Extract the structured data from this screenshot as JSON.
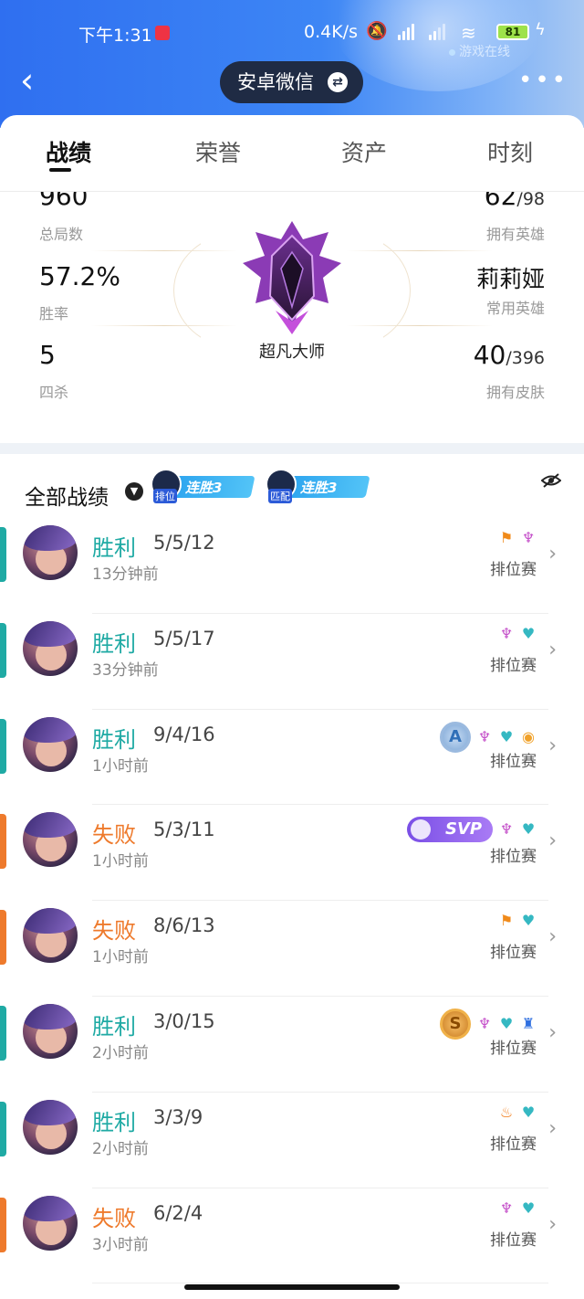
{
  "status_bar": {
    "time": "下午1:31",
    "net_speed": "0.4K/s",
    "battery": "81",
    "online_label": "游戏在线"
  },
  "nav": {
    "account_label": "安卓微信",
    "swap_symbol": "⇄",
    "back_symbol": "‹",
    "more_symbol": "•••"
  },
  "tabs": [
    "战绩",
    "荣誉",
    "资产",
    "时刻"
  ],
  "stats": {
    "total_games": "960",
    "total_games_label": "总局数",
    "win_rate": "57.2%",
    "win_rate_label": "胜率",
    "quadra": "5",
    "quadra_label": "四杀",
    "heroes_owned": "62",
    "heroes_total": "/98",
    "heroes_label": "拥有英雄",
    "common_hero": "莉莉娅",
    "common_hero_label": "常用英雄",
    "skins_owned": "40",
    "skins_total": "/396",
    "skins_label": "拥有皮肤",
    "rank_name": "超凡大师"
  },
  "records": {
    "title": "全部战绩",
    "badges": [
      {
        "tag": "排位",
        "text": "连胜3"
      },
      {
        "tag": "匹配",
        "text": "连胜3"
      }
    ]
  },
  "colors": {
    "win": "#1faaa4",
    "loss": "#ee7a2c"
  },
  "matches": [
    {
      "result": "胜利",
      "kda": "5/5/12",
      "ago": "13分钟前",
      "mode": "排位赛",
      "win": true,
      "icons": [
        "flag-icon",
        "demon-icon"
      ]
    },
    {
      "result": "胜利",
      "kda": "5/5/17",
      "ago": "33分钟前",
      "mode": "排位赛",
      "win": true,
      "icons": [
        "demon-icon",
        "heart-icon"
      ]
    },
    {
      "result": "胜利",
      "kda": "9/4/16",
      "ago": "1小时前",
      "mode": "排位赛",
      "win": true,
      "medal": "A",
      "icons": [
        "demon-icon",
        "heart-icon",
        "coin-icon"
      ]
    },
    {
      "result": "失败",
      "kda": "5/3/11",
      "ago": "1小时前",
      "mode": "排位赛",
      "win": false,
      "svp": "SVP",
      "icons": [
        "demon-icon",
        "heart-icon"
      ]
    },
    {
      "result": "失败",
      "kda": "8/6/13",
      "ago": "1小时前",
      "mode": "排位赛",
      "win": false,
      "icons": [
        "flag-icon",
        "heart-icon"
      ]
    },
    {
      "result": "胜利",
      "kda": "3/0/15",
      "ago": "2小时前",
      "mode": "排位赛",
      "win": true,
      "medal": "S",
      "icons": [
        "demon-icon",
        "heart-icon",
        "tower-icon"
      ]
    },
    {
      "result": "胜利",
      "kda": "3/3/9",
      "ago": "2小时前",
      "mode": "排位赛",
      "win": true,
      "icons": [
        "fire-icon",
        "heart-icon"
      ]
    },
    {
      "result": "失败",
      "kda": "6/2/4",
      "ago": "3小时前",
      "mode": "排位赛",
      "win": false,
      "icons": [
        "demon-icon",
        "heart-icon"
      ]
    }
  ]
}
